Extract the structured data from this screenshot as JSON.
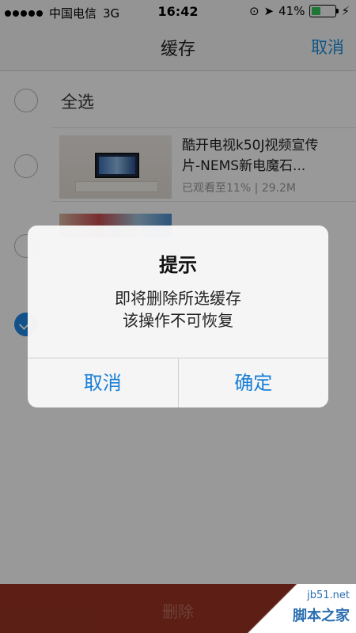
{
  "status_bar": {
    "carrier": "中国电信",
    "network": "3G",
    "time": "16:42",
    "battery_percent": "41%",
    "battery_level": 0.41
  },
  "nav": {
    "title": "缓存",
    "cancel_label": "取消"
  },
  "select_all_label": "全选",
  "videos": [
    {
      "title_line1": "酷开电视k50J视频宣传",
      "title_line2": "片-NEMS新电魔石...",
      "progress": "已观看至11%",
      "size": "29.2M",
      "checked": false
    },
    {
      "checked": false
    },
    {
      "checked": true
    }
  ],
  "dialog": {
    "title": "提示",
    "message_line1": "即将删除所选缓存",
    "message_line2": "该操作不可恢复",
    "cancel_label": "取消",
    "confirm_label": "确定"
  },
  "bottom_bar": {
    "delete_label": "删除"
  },
  "watermark": {
    "url": "jb51.net",
    "text": "脚本之家"
  },
  "colors": {
    "accent": "#1a8fe0",
    "delete_bar": "#9a3324",
    "checked": "#1e88e5"
  }
}
